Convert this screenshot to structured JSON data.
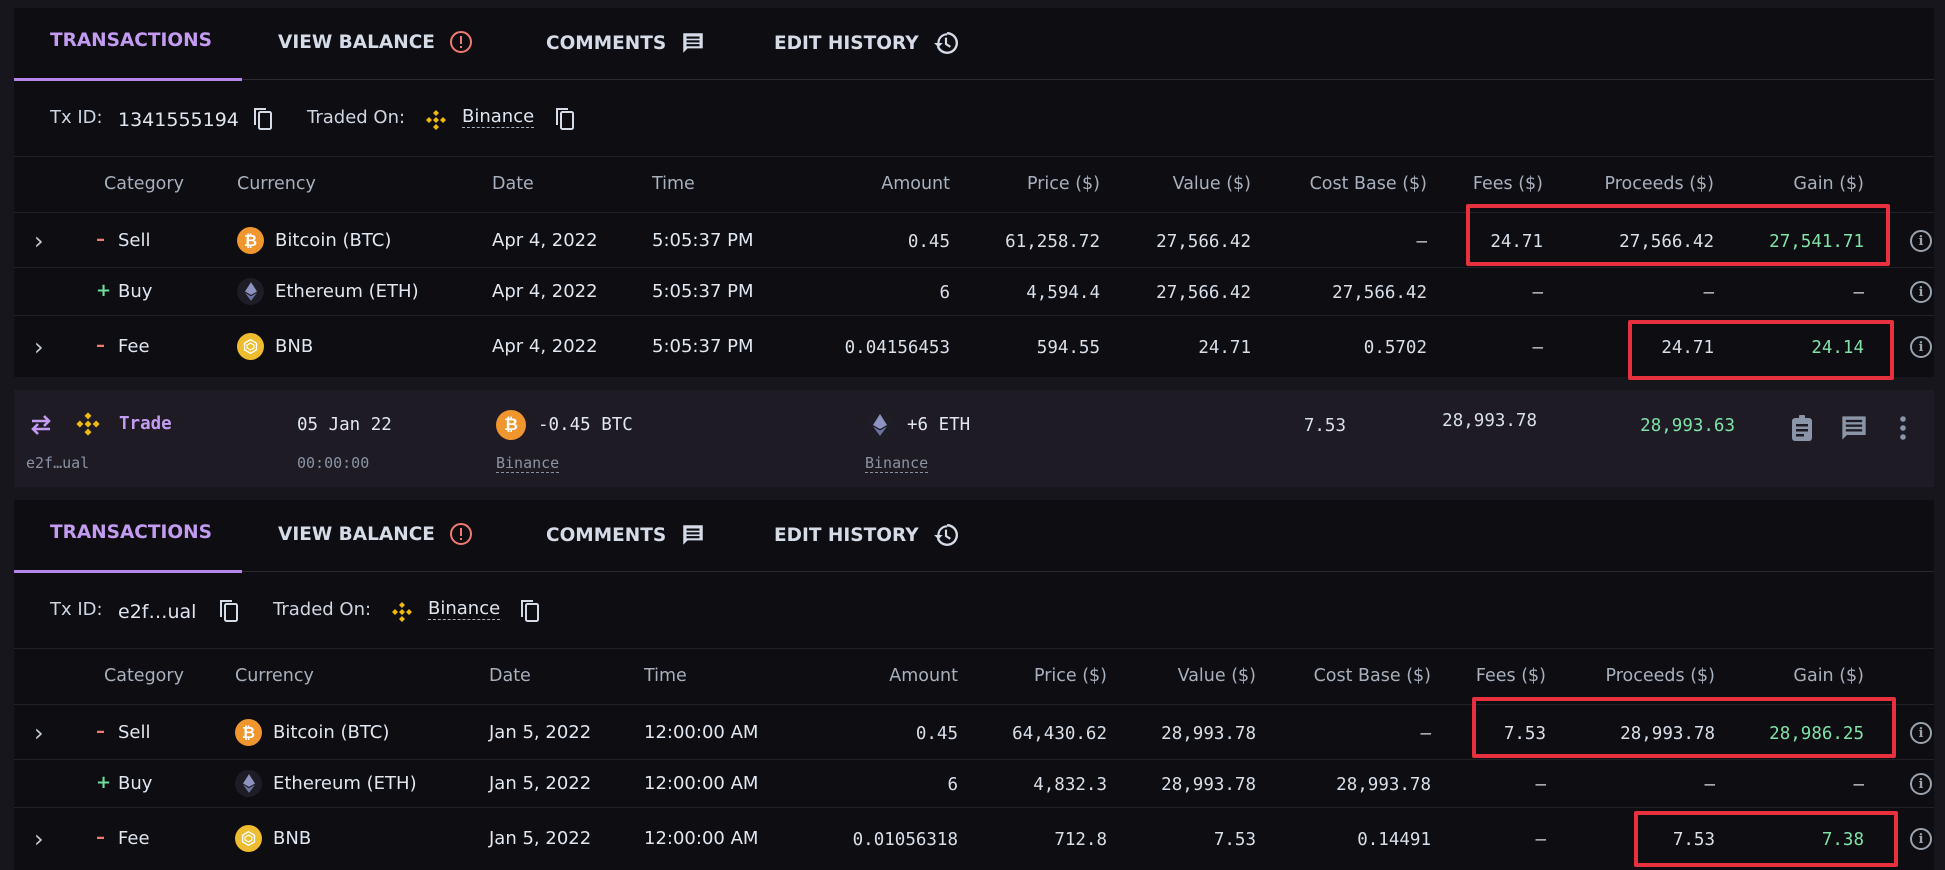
{
  "tabs": [
    {
      "label": "TRANSACTIONS",
      "icon": null,
      "active": true
    },
    {
      "label": "VIEW BALANCE",
      "icon": "alert-circle-icon",
      "active": false
    },
    {
      "label": "COMMENTS",
      "icon": "comment-icon",
      "active": false
    },
    {
      "label": "EDIT HISTORY",
      "icon": "history-icon",
      "active": false
    }
  ],
  "columns": [
    "Category",
    "Currency",
    "Date",
    "Time",
    "Amount",
    "Price ($)",
    "Value ($)",
    "Cost Base ($)",
    "Fees ($)",
    "Proceeds ($)",
    "Gain ($)"
  ],
  "colors": {
    "accent": "#b786ec",
    "gain": "#7fe3a8",
    "minus": "#f07b73",
    "plus": "#6fdca2",
    "highlight": "#e8313f",
    "alert": "#f07b73"
  },
  "panels": [
    {
      "meta": {
        "txid_label": "Tx ID:",
        "txid": "1341555194",
        "traded_on_label": "Traded On:",
        "exchange": "Binance"
      },
      "rows": [
        {
          "sign": "–",
          "category": "Sell",
          "coin": "btc",
          "currency": "Bitcoin (BTC)",
          "date": "Apr 4, 2022",
          "time": "5:05:37 PM",
          "amount": "0.45",
          "price": "61,258.72",
          "value": "27,566.42",
          "cost_base": "–",
          "fees": "24.71",
          "proceeds": "27,566.42",
          "gain": "27,541.71",
          "expandable": true
        },
        {
          "sign": "+",
          "category": "Buy",
          "coin": "eth",
          "currency": "Ethereum (ETH)",
          "date": "Apr 4, 2022",
          "time": "5:05:37 PM",
          "amount": "6",
          "price": "4,594.4",
          "value": "27,566.42",
          "cost_base": "27,566.42",
          "fees": "–",
          "proceeds": "–",
          "gain": "–",
          "expandable": false
        },
        {
          "sign": "–",
          "category": "Fee",
          "coin": "bnb",
          "currency": "BNB",
          "date": "Apr 4, 2022",
          "time": "5:05:37 PM",
          "amount": "0.04156453",
          "price": "594.55",
          "value": "24.71",
          "cost_base": "0.5702",
          "fees": "–",
          "proceeds": "24.71",
          "gain": "24.14",
          "expandable": true
        }
      ]
    },
    {
      "meta": {
        "txid_label": "Tx ID:",
        "txid": "e2f…ual",
        "traded_on_label": "Traded On:",
        "exchange": "Binance"
      },
      "rows": [
        {
          "sign": "–",
          "category": "Sell",
          "coin": "btc",
          "currency": "Bitcoin (BTC)",
          "date": "Jan 5, 2022",
          "time": "12:00:00 AM",
          "amount": "0.45",
          "price": "64,430.62",
          "value": "28,993.78",
          "cost_base": "–",
          "fees": "7.53",
          "proceeds": "28,993.78",
          "gain": "28,986.25",
          "expandable": true
        },
        {
          "sign": "+",
          "category": "Buy",
          "coin": "eth",
          "currency": "Ethereum (ETH)",
          "date": "Jan 5, 2022",
          "time": "12:00:00 AM",
          "amount": "6",
          "price": "4,832.3",
          "value": "28,993.78",
          "cost_base": "28,993.78",
          "fees": "–",
          "proceeds": "–",
          "gain": "–",
          "expandable": false
        },
        {
          "sign": "–",
          "category": "Fee",
          "coin": "bnb",
          "currency": "BNB",
          "date": "Jan 5, 2022",
          "time": "12:00:00 AM",
          "amount": "0.01056318",
          "price": "712.8",
          "value": "7.53",
          "cost_base": "0.14491",
          "fees": "–",
          "proceeds": "7.53",
          "gain": "7.38",
          "expandable": true
        }
      ]
    }
  ],
  "trade": {
    "type": "Trade",
    "id": "e2f…ual",
    "date": "05 Jan 22",
    "time": "00:00:00",
    "sent": "-0.45 BTC",
    "sent_exchange": "Binance",
    "received": "+6 ETH",
    "received_exchange": "Binance",
    "fee": "7.53",
    "value": "28,993.78",
    "gain": "28,993.63"
  }
}
